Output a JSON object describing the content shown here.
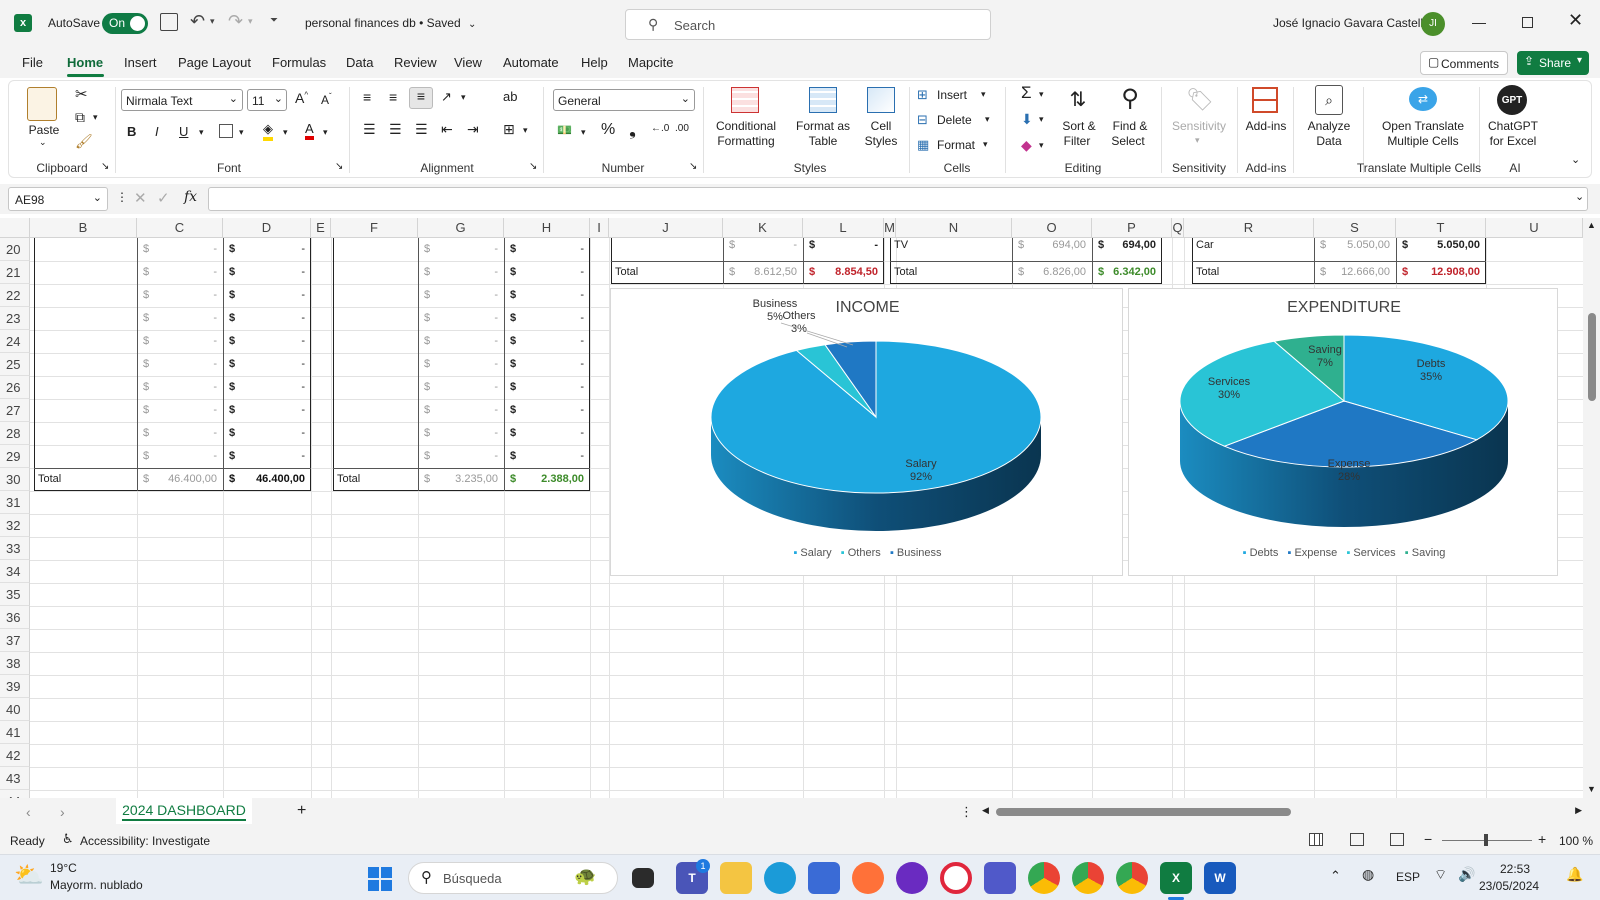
{
  "title_bar": {
    "autosave_label": "AutoSave",
    "autosave_state": "On",
    "doc_title": "personal finances db • Saved",
    "search_placeholder": "Search",
    "user_name": "José Ignacio Gavara Castell",
    "user_initials": "JI"
  },
  "menu": {
    "items": [
      "File",
      "Home",
      "Insert",
      "Page Layout",
      "Formulas",
      "Data",
      "Review",
      "View",
      "Automate",
      "Help",
      "Mapcite"
    ],
    "comments_label": "Comments",
    "share_label": "Share"
  },
  "ribbon": {
    "paste_label": "Paste",
    "font_name": "Nirmala Text",
    "font_size": "11",
    "number_format": "General",
    "cond_format_1": "Conditional",
    "cond_format_2": "Formatting",
    "format_table_1": "Format as",
    "format_table_2": "Table",
    "cell_styles_1": "Cell",
    "cell_styles_2": "Styles",
    "insert_label": "Insert",
    "delete_label": "Delete",
    "format_label": "Format",
    "sort_1": "Sort &",
    "sort_2": "Filter",
    "find_1": "Find &",
    "find_2": "Select",
    "sensitivity_label": "Sensitivity",
    "addins_label": "Add-ins",
    "analyze_1": "Analyze",
    "analyze_2": "Data",
    "translate_1": "Open Translate",
    "translate_2": "Multiple Cells",
    "gpt_icon_text": "GPT",
    "gpt_1": "ChatGPT",
    "gpt_2": "for Excel",
    "groups": [
      "Clipboard",
      "Font",
      "Alignment",
      "Number",
      "Styles",
      "Cells",
      "Editing",
      "Sensitivity",
      "Add-ins",
      "Translate Multiple Cells",
      "AI"
    ]
  },
  "formula_bar": {
    "name_box": "AE98",
    "formula": ""
  },
  "columns": [
    "B",
    "C",
    "D",
    "E",
    "F",
    "G",
    "H",
    "I",
    "J",
    "K",
    "L",
    "M",
    "N",
    "O",
    "P",
    "Q",
    "R",
    "S",
    "T",
    "U"
  ],
  "rows": [
    "20",
    "21",
    "22",
    "23",
    "24",
    "25",
    "26",
    "27",
    "28",
    "29",
    "30",
    "31",
    "32",
    "33",
    "34",
    "35",
    "36",
    "37",
    "38",
    "39",
    "40",
    "41",
    "42",
    "43",
    "44"
  ],
  "cells": {
    "currency": "$",
    "dash": "-",
    "total_label": "Total",
    "tbl1_total_c": "46.400,00",
    "tbl1_total_d": "46.400,00",
    "tbl2_total_g": "3.235,00",
    "tbl2_total_h": "2.388,00",
    "tbl3_total_k": "8.612,50",
    "tbl3_total_l": "8.854,50",
    "tbl4_row20_label": "TV",
    "tbl4_row20_o": "694,00",
    "tbl4_row20_p": "694,00",
    "tbl4_total_o": "6.826,00",
    "tbl4_total_p": "6.342,00",
    "tbl5_row20_label": "Car",
    "tbl5_row20_s": "5.050,00",
    "tbl5_row20_t": "5.050,00",
    "tbl5_total_s": "12.666,00",
    "tbl5_total_t": "12.908,00"
  },
  "chart_data": [
    {
      "type": "pie",
      "title": "INCOME",
      "categories": [
        "Salary",
        "Others",
        "Business"
      ],
      "values": [
        92,
        3,
        5
      ],
      "label_names": [
        "Salary",
        "Others",
        "Business"
      ],
      "label_pcts": [
        "92%",
        "3%",
        "5%"
      ],
      "colors": [
        "#1ea8e0",
        "#29c4d6",
        "#1f78c4"
      ],
      "legend": [
        "Salary",
        "Others",
        "Business"
      ],
      "legend_position": "bottom"
    },
    {
      "type": "pie",
      "title": "EXPENDITURE",
      "categories": [
        "Debts",
        "Expense",
        "Services",
        "Saving"
      ],
      "values": [
        35,
        28,
        30,
        7
      ],
      "label_names": [
        "Debts",
        "Expense",
        "Services",
        "Saving"
      ],
      "label_pcts": [
        "35%",
        "28%",
        "30%",
        "7%"
      ],
      "colors": [
        "#1ea8e0",
        "#1f78c4",
        "#29c4d6",
        "#2fb08f"
      ],
      "legend": [
        "Debts",
        "Expense",
        "Services",
        "Saving"
      ],
      "legend_position": "bottom"
    }
  ],
  "sheet_tabs": {
    "active": "2024 DASHBOARD"
  },
  "status_bar": {
    "ready": "Ready",
    "accessibility": "Accessibility: Investigate",
    "zoom": "100 %"
  },
  "taskbar": {
    "weather_temp": "19°C",
    "weather_desc": "Mayorm. nublado",
    "search_placeholder": "Búsqueda",
    "lang": "ESP",
    "time": "22:53",
    "date": "23/05/2024",
    "teams_badge": "1"
  }
}
